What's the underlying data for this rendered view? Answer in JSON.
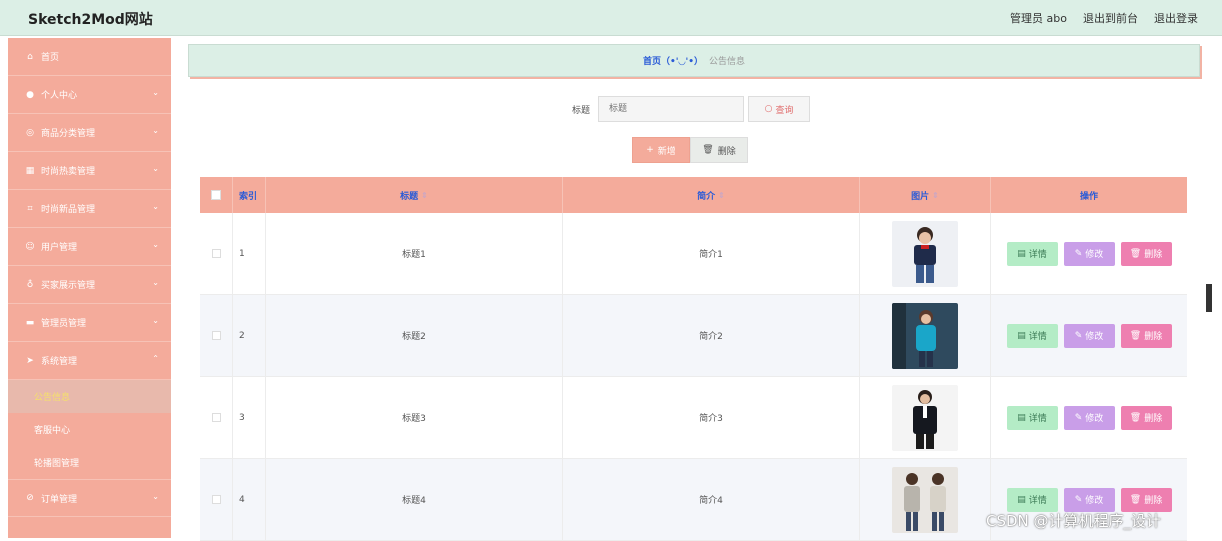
{
  "app": {
    "title": "Sketch2Mod网站"
  },
  "header": {
    "admin_label": "管理员 abo",
    "to_front": "退出到前台",
    "logout": "退出登录"
  },
  "sidebar": {
    "items": [
      {
        "label": "首页",
        "icon": "home-icon",
        "expandable": false
      },
      {
        "label": "个人中心",
        "icon": "user-icon",
        "expandable": true
      },
      {
        "label": "商品分类管理",
        "icon": "globe-icon",
        "expandable": true
      },
      {
        "label": "时尚热卖管理",
        "icon": "grid-icon",
        "expandable": true
      },
      {
        "label": "时尚新品管理",
        "icon": "crop-icon",
        "expandable": true
      },
      {
        "label": "用户管理",
        "icon": "face-icon",
        "expandable": true
      },
      {
        "label": "买家展示管理",
        "icon": "bulb-icon",
        "expandable": true
      },
      {
        "label": "管理员管理",
        "icon": "ticket-icon",
        "expandable": true
      },
      {
        "label": "系统管理",
        "icon": "send-icon",
        "expandable": true,
        "expanded": true
      }
    ],
    "sub_items": [
      {
        "label": "公告信息",
        "active": true
      },
      {
        "label": "客服中心",
        "active": false
      },
      {
        "label": "轮播图管理",
        "active": false
      }
    ],
    "after": {
      "label": "订单管理",
      "icon": "compass-icon",
      "expandable": true
    }
  },
  "breadcrumb": {
    "home": "首页（•'◡'•）",
    "current": "公告信息"
  },
  "search": {
    "label": "标题",
    "placeholder": "标题",
    "button": "查询"
  },
  "toolbar": {
    "add": "新增",
    "delete": "删除"
  },
  "table": {
    "headers": {
      "index": "索引",
      "title": "标题",
      "intro": "简介",
      "image": "图片",
      "ops": "操作"
    },
    "ops": {
      "detail": "详情",
      "edit": "修改",
      "delete": "删除"
    },
    "rows": [
      {
        "index": "1",
        "title": "标题1",
        "intro": "简介1"
      },
      {
        "index": "2",
        "title": "标题2",
        "intro": "简介2"
      },
      {
        "index": "3",
        "title": "标题3",
        "intro": "简介3"
      },
      {
        "index": "4",
        "title": "标题4",
        "intro": "简介4"
      }
    ]
  },
  "watermark": "CSDN @计算机程序_设计",
  "colors": {
    "accent": "#f4ab9b",
    "header_bg": "#dcefe6",
    "link_blue": "#2a5bd7"
  }
}
